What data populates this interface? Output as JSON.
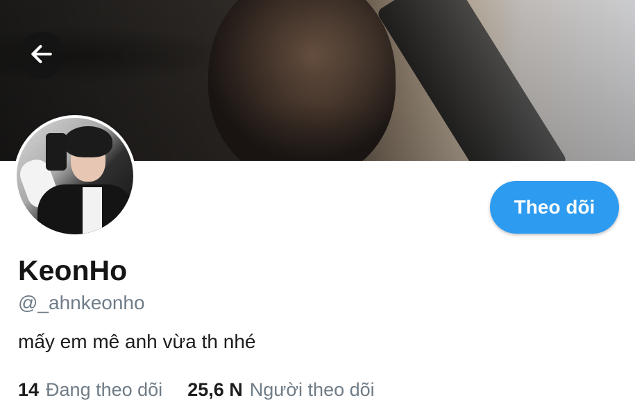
{
  "profile": {
    "name": "KeonHo",
    "handle": "@_ahnkeonho",
    "bio": "mấy em mê anh vừa th nhé"
  },
  "actions": {
    "follow_label": "Theo dõi"
  },
  "stats": {
    "following_count": "14",
    "following_label": "Đang theo dõi",
    "followers_count": "25,6 N",
    "followers_label": "Người theo dõi"
  },
  "icons": {
    "back": "arrow-left-icon"
  },
  "colors": {
    "accent": "#2d9bf0",
    "secondary_text": "#6f7c87",
    "primary_text": "#151515"
  }
}
